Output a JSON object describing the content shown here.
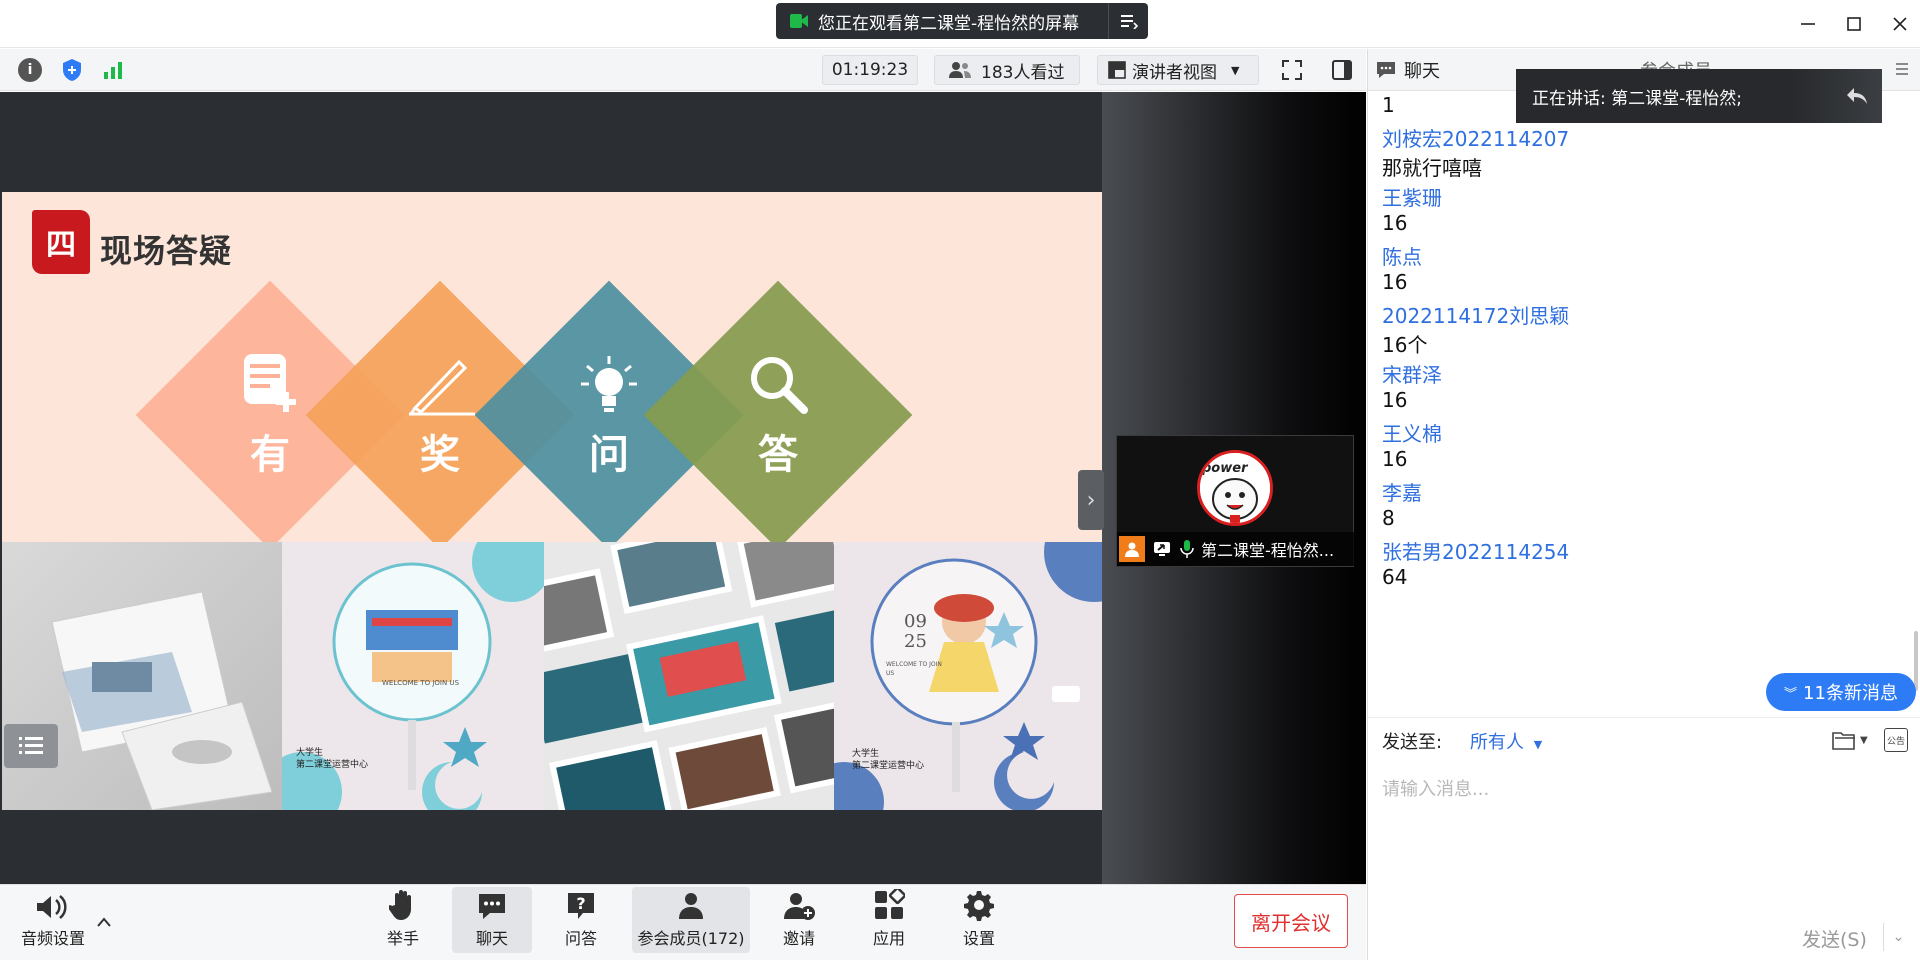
{
  "titlebar": {
    "banner_text": "您正在观看第二课堂-程怡然的屏幕"
  },
  "toolbar": {
    "timer": "01:19:23",
    "viewers": "183人看过",
    "view_mode": "演讲者视图"
  },
  "slide": {
    "badge": "四",
    "heading": "现场答疑",
    "diamonds": [
      {
        "char": "有",
        "color": "#fdb197",
        "icon": "form-add-icon"
      },
      {
        "char": "奖",
        "color": "#f4a259",
        "icon": "pen-icon"
      },
      {
        "char": "问",
        "color": "#4c8fa0",
        "icon": "lightbulb-icon"
      },
      {
        "char": "答",
        "color": "#859b4e",
        "icon": "magnifier-icon"
      }
    ],
    "fan_date_top": "09",
    "fan_date_bottom": "25",
    "fan_caption_1": "WELCOME TO JOIN US",
    "fan_caption_2": "WELCOME TO JOIN US",
    "org_line_1": "大学生",
    "org_line_2": "第二课堂运营中心"
  },
  "speaker": {
    "name": "第二课堂-程怡然...",
    "avatar_text": "power"
  },
  "bottom": {
    "audio": "音频设置",
    "raise_hand": "举手",
    "chat": "聊天",
    "qa": "问答",
    "members": "参会成员(172)",
    "invite": "邀请",
    "apps": "应用",
    "settings": "设置",
    "leave": "离开会议"
  },
  "chat": {
    "tab_chat": "聊天",
    "tab_members": "参会成员",
    "speaking": "正在讲话: 第二课堂-程怡然;",
    "messages": [
      {
        "type": "text",
        "content": "1"
      },
      {
        "type": "sender",
        "content": "刘桉宏2022114207"
      },
      {
        "type": "text",
        "content": "那就行嘻嘻"
      },
      {
        "type": "sender",
        "content": "王紫珊"
      },
      {
        "type": "text",
        "content": "16"
      },
      {
        "type": "sender",
        "content": "陈点"
      },
      {
        "type": "text",
        "content": "16"
      },
      {
        "type": "sender",
        "content": "2022114172刘思颖"
      },
      {
        "type": "text",
        "content": "16个"
      },
      {
        "type": "sender",
        "content": "宋群泽"
      },
      {
        "type": "text",
        "content": "16"
      },
      {
        "type": "sender",
        "content": "王义棉"
      },
      {
        "type": "text",
        "content": "16"
      },
      {
        "type": "sender",
        "content": "李嘉"
      },
      {
        "type": "text",
        "content": "8"
      },
      {
        "type": "sender",
        "content": "张若男2022114254"
      },
      {
        "type": "text",
        "content": "64"
      }
    ],
    "new_messages": "11条新消息",
    "send_to_label": "发送至:",
    "send_to_value": "所有人",
    "placeholder": "请输入消息...",
    "send": "发送(S)",
    "notice_icon_text": "公告"
  }
}
